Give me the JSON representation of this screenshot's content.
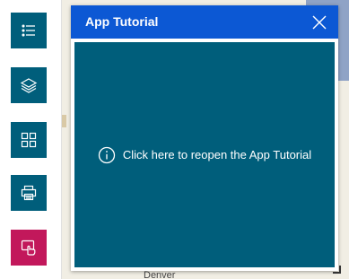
{
  "toolbar": {
    "buttons": [
      {
        "name": "legend-list-icon"
      },
      {
        "name": "layers-icon"
      },
      {
        "name": "basemap-gallery-icon"
      },
      {
        "name": "print-icon"
      },
      {
        "name": "tutorial-hand-icon"
      }
    ]
  },
  "dialog": {
    "title": "App Tutorial",
    "close_icon": "close-icon",
    "body_text": "Click here to reopen the App Tutorial",
    "info_icon": "info-icon"
  },
  "map": {
    "label": "Denver"
  },
  "colors": {
    "toolbar_button": "#005e7b",
    "toolbar_button_active": "#c2185b",
    "dialog_header": "#0c58d4",
    "dialog_body": "#005e7b"
  }
}
